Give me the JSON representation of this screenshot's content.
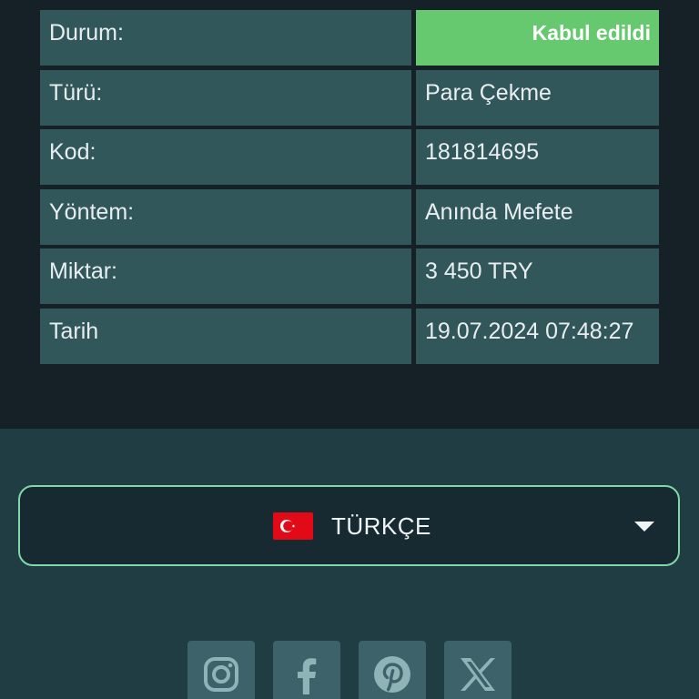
{
  "details": {
    "rows": [
      {
        "label": "Durum:",
        "value": "Kabul edildi"
      },
      {
        "label": "Türü:",
        "value": "Para Çekme"
      },
      {
        "label": "Kod:",
        "value": "181814695"
      },
      {
        "label": "Yöntem:",
        "value": "Anında Mefete"
      },
      {
        "label": "Miktar:",
        "value": "3 450 TRY"
      },
      {
        "label": "Tarih",
        "value": "19.07.2024 07:48:27"
      }
    ]
  },
  "language": {
    "selected": "TÜRKÇE",
    "flag_icon": "turkey-flag-icon"
  },
  "socials": [
    {
      "name": "instagram-icon"
    },
    {
      "name": "facebook-icon"
    },
    {
      "name": "pinterest-icon"
    },
    {
      "name": "x-icon"
    }
  ],
  "colors": {
    "status_accepted": "#67c96f",
    "cell_background": "#31575a",
    "select_border": "#7fd9a6"
  }
}
